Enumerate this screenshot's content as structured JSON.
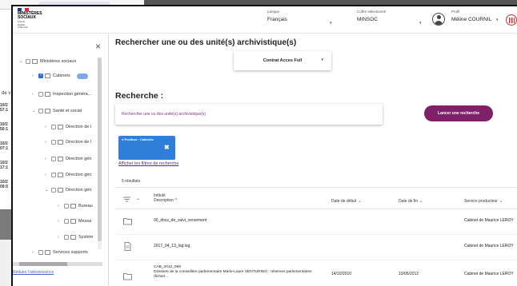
{
  "background": {
    "label": "de v",
    "dates": [
      {
        "date": "10/2",
        "time": "57:1"
      },
      {
        "date": "10/2",
        "time": "50:1"
      },
      {
        "date": "10/2",
        "time": "07:1"
      },
      {
        "date": "10/2",
        "time": "17:1"
      },
      {
        "date": "10/2",
        "time": "09:5"
      }
    ]
  },
  "header": {
    "logo_line1": "MINISTÈRES",
    "logo_line2": "SOCIAUX",
    "motto": [
      "Liberté",
      "Égalité",
      "Fraternité"
    ],
    "langue_label": "Langue",
    "langue_value": "Français",
    "coffre_label": "Coffre sélectionné",
    "coffre_value": "MINSOC",
    "profil_label": "Profil",
    "profil_value": "Méline COURNIL",
    "caret": "▾"
  },
  "tree": {
    "close": "×",
    "items": [
      {
        "label": "Ministères sociaux",
        "expanded": true,
        "checked": false
      },
      {
        "label": "Cabinets",
        "expanded": false,
        "checked": true
      },
      {
        "label": "Inspection généra...",
        "expanded": false,
        "checked": false
      },
      {
        "label": "Santé et social",
        "expanded": true,
        "checked": false
      },
      {
        "label": "Direction de l",
        "expanded": false,
        "checked": false
      },
      {
        "label": "Direction de l",
        "expanded": false,
        "checked": false
      },
      {
        "label": "Direction gén",
        "expanded": false,
        "checked": false
      },
      {
        "label": "Direction gén",
        "expanded": false,
        "checked": false
      },
      {
        "label": "Direction gén",
        "expanded": true,
        "checked": false
      },
      {
        "label": "Bureau",
        "expanded": false,
        "checked": false
      },
      {
        "label": "Messa",
        "expanded": false,
        "checked": false
      },
      {
        "label": "Systèm",
        "expanded": false,
        "checked": false
      },
      {
        "label": "Services supports",
        "expanded": false,
        "checked": false
      }
    ],
    "reduce_link": "Réduire l'arborescence"
  },
  "main": {
    "title": "Rechercher une ou des unité(s) archivistique(s)",
    "contract": "Contrat Acces Full",
    "search_title": "Recherche :",
    "search_placeholder": "Rechercher une ou des unité(s) archivistique(s)",
    "search_button": "Lancer une recherche",
    "filter_chip": "Position : Cabinets",
    "filter_remove": "✖",
    "filters_link": "Afficher les filtres de recherche",
    "results_count": "5 résultats"
  },
  "table": {
    "headers": {
      "intitule": "Intitulé",
      "description": "Description",
      "start_date": "Date de début",
      "end_date": "Date de fin",
      "service": "Service producteur"
    },
    "rows": [
      {
        "icon": "folder-icon",
        "title": "00_docs_de_suivi_versement",
        "start_date": "",
        "end_date": "",
        "service": "Cabinet de Maurice LEROY"
      },
      {
        "icon": "file-icon",
        "title": "2017_04_13_log.log",
        "start_date": "",
        "end_date": "",
        "service": "Cabinet de Maurice LEROY"
      },
      {
        "icon": "folder-icon",
        "title": "CAB_2012_069",
        "description": "Dossiers de la conseillère parlementaire Marie-Laure VENTURINO : réserves parlementaires (fichier...",
        "start_date": "14/10/2010",
        "end_date": "10/05/2012",
        "service": "Cabinet de Maurice LEROY"
      }
    ]
  },
  "colors": {
    "accent_purple": "#7d2268",
    "chip_blue": "#2f7fd9",
    "checkbox_blue": "#2b6cd4"
  }
}
